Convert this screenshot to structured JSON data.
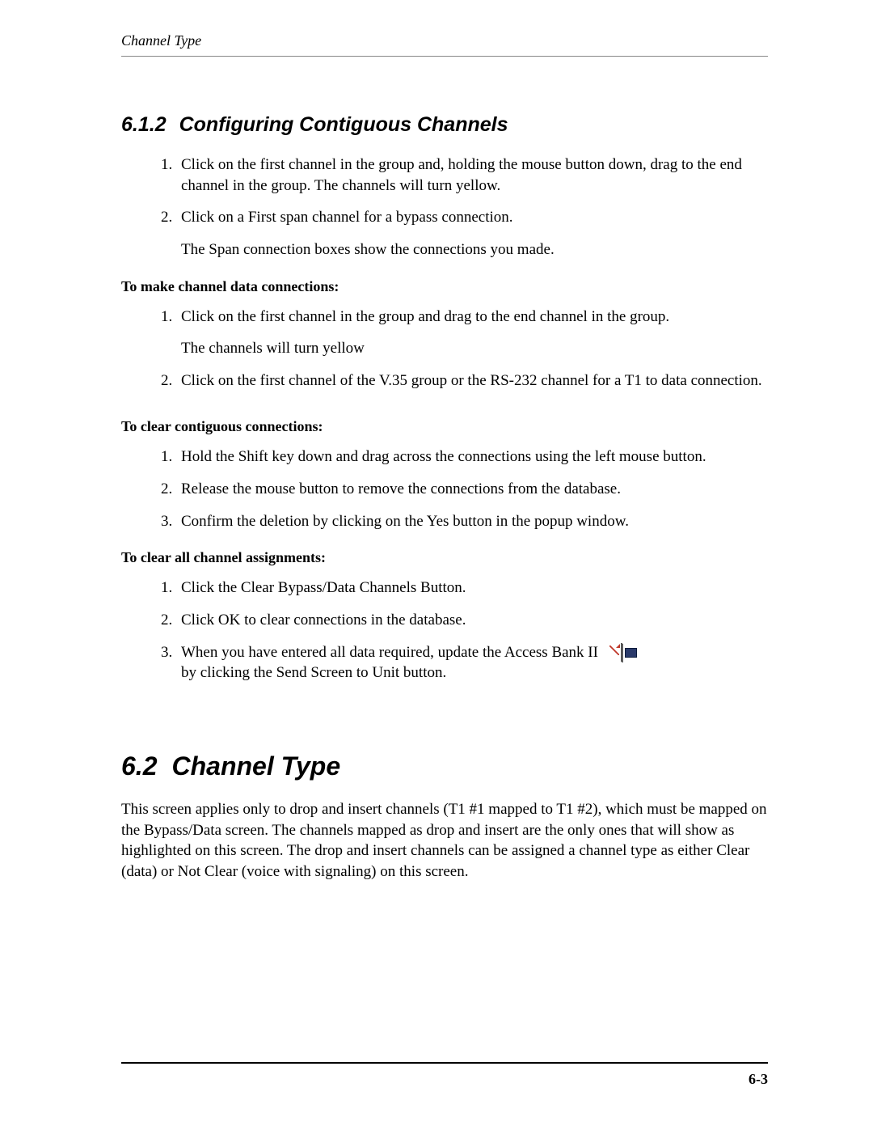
{
  "header": {
    "running_title": "Channel Type"
  },
  "section_612": {
    "number": "6.1.2",
    "title": "Configuring Contiguous Channels",
    "steps": [
      "Click on the first channel in the group and, holding the mouse button down, drag to the end channel in the group. The channels will turn yellow.",
      "Click on a First span channel for a bypass connection."
    ],
    "step2_note": "The Span connection boxes show the connections you made."
  },
  "make_data": {
    "heading": "To make channel data connections:",
    "steps": [
      {
        "text": "Click on the first channel in the group and drag to the end channel in the group.",
        "note": "The channels will turn yellow"
      },
      {
        "text": "Click on the first channel of the V.35 group or the RS-232 channel for a T1 to data connection."
      }
    ]
  },
  "clear_contig": {
    "heading": "To clear contiguous connections:",
    "steps": [
      "Hold the Shift key down and drag across the connections using the left mouse button.",
      "Release the mouse button to remove the connections from the database.",
      "Confirm the deletion by clicking on the Yes button in the popup window."
    ]
  },
  "clear_all": {
    "heading": "To clear all channel assignments:",
    "steps": [
      {
        "prefix": "Click the ",
        "term": "Clear Bypass/Data Channels",
        "suffix": " Button."
      },
      {
        "prefix": "Click ",
        "term": "OK",
        "suffix": " to clear connections in the database."
      },
      {
        "text": "When you have entered all data required, update the Access Bank II by clicking the Send Screen to Unit button."
      }
    ]
  },
  "section_62": {
    "number": "6.2",
    "title": "Channel Type",
    "para": "This screen applies only to drop and insert channels (T1 #1 mapped to T1 #2), which must be mapped on the Bypass/Data screen. The channels mapped as drop and insert are the only ones that will show as highlighted on this screen. The drop and insert channels can be assigned a channel type as either Clear (data) or Not Clear (voice with signaling) on this screen."
  },
  "footer": {
    "page_number": "6-3"
  },
  "icons": {
    "send_screen": "send-screen-to-unit-icon"
  }
}
